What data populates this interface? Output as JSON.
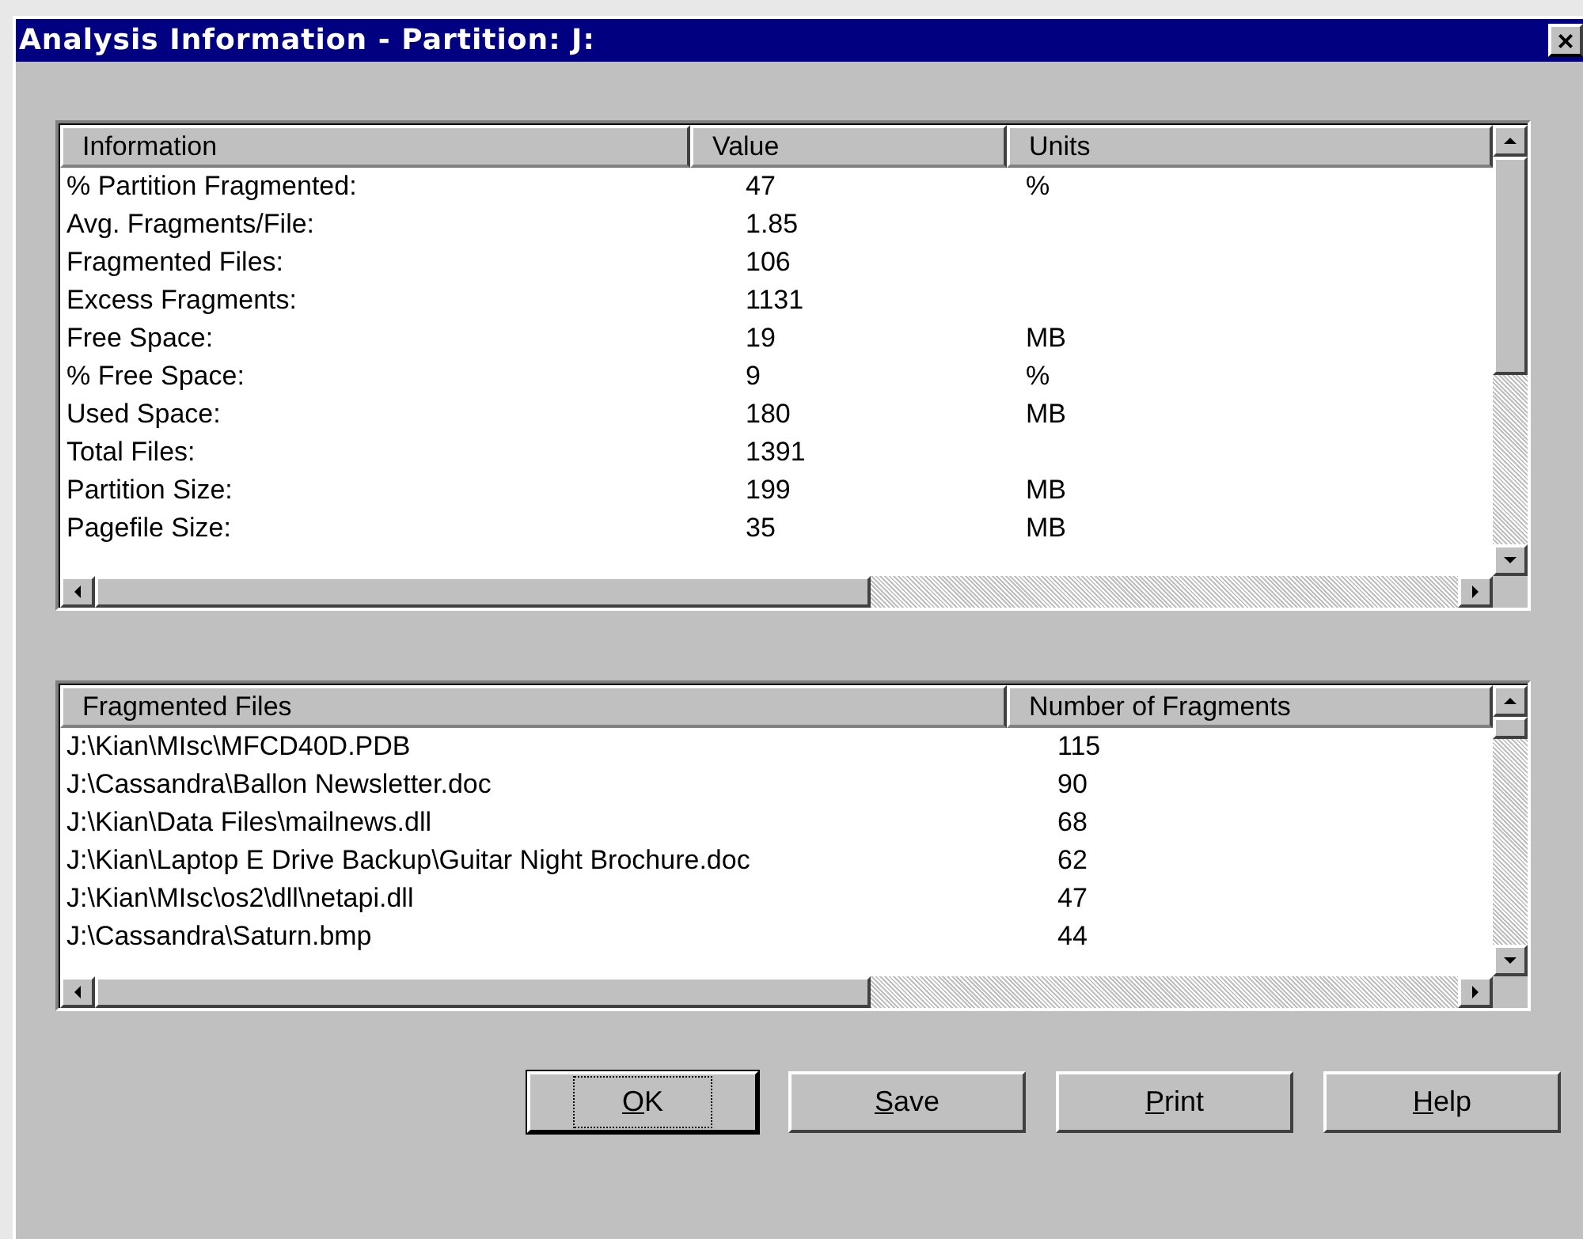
{
  "window": {
    "title": "Analysis Information - Partition: J:",
    "close": "×"
  },
  "info_table": {
    "columns": [
      "Information",
      "Value",
      "Units"
    ],
    "rows": [
      {
        "cells": [
          "% Partition Fragmented:",
          "47",
          "%"
        ]
      },
      {
        "cells": [
          "Avg. Fragments/File:",
          "1.85",
          ""
        ]
      },
      {
        "cells": [
          "Fragmented Files:",
          "106",
          ""
        ]
      },
      {
        "cells": [
          "Excess Fragments:",
          "1131",
          ""
        ]
      },
      {
        "cells": [
          "Free Space:",
          "19",
          "MB"
        ]
      },
      {
        "cells": [
          "% Free Space:",
          "9",
          "%"
        ]
      },
      {
        "cells": [
          "Used Space:",
          "180",
          "MB"
        ]
      },
      {
        "cells": [
          "Total Files:",
          "1391",
          ""
        ]
      },
      {
        "cells": [
          "Partition Size:",
          "199",
          "MB"
        ]
      },
      {
        "cells": [
          "Pagefile Size:",
          "35",
          "MB"
        ]
      }
    ]
  },
  "files_table": {
    "columns": [
      "Fragmented Files",
      "Number of Fragments"
    ],
    "rows": [
      {
        "cells": [
          "J:\\Kian\\MIsc\\MFCD40D.PDB",
          "115"
        ]
      },
      {
        "cells": [
          "J:\\Cassandra\\Ballon Newsletter.doc",
          "90"
        ]
      },
      {
        "cells": [
          "J:\\Kian\\Data Files\\mailnews.dll",
          "68"
        ]
      },
      {
        "cells": [
          "J:\\Kian\\Laptop E Drive Backup\\Guitar Night Brochure.doc",
          "62"
        ]
      },
      {
        "cells": [
          "J:\\Kian\\MIsc\\os2\\dll\\netapi.dll",
          "47"
        ]
      },
      {
        "cells": [
          "J:\\Cassandra\\Saturn.bmp",
          "44"
        ]
      }
    ]
  },
  "buttons": [
    {
      "label": "OK",
      "default": true,
      "mnemonic_first": true
    },
    {
      "label": "Save",
      "default": false,
      "mnemonic_first": true
    },
    {
      "label": "Print",
      "default": false,
      "mnemonic_first": true
    },
    {
      "label": "Help",
      "default": false,
      "mnemonic_first": true
    }
  ]
}
